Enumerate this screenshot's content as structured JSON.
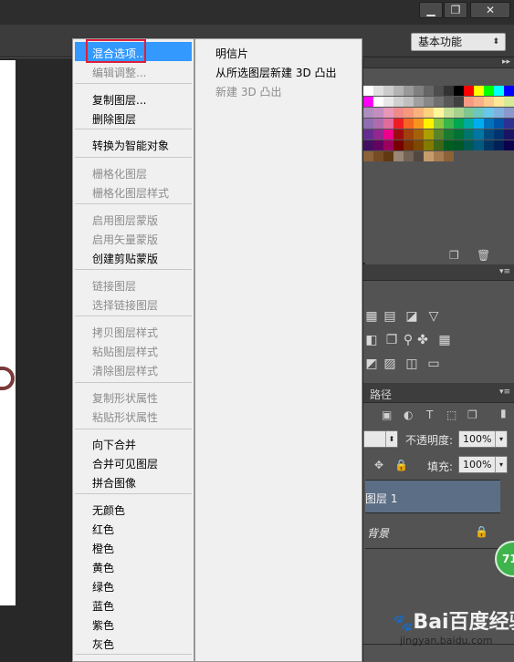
{
  "window": {
    "minimize_glyph": "▁",
    "restore_glyph": "❐",
    "close_glyph": "✕"
  },
  "workspace": {
    "value": "基本功能",
    "arrow": "⬍"
  },
  "menu": {
    "highlighted": "混合选项...",
    "items": [
      {
        "label": "混合选项...",
        "enabled": true
      },
      {
        "label": "编辑调整...",
        "enabled": false
      },
      {
        "label": "复制图层...",
        "enabled": true
      },
      {
        "label": "删除图层",
        "enabled": true
      },
      {
        "label": "转换为智能对象",
        "enabled": true
      },
      {
        "label": "栅格化图层",
        "enabled": false
      },
      {
        "label": "栅格化图层样式",
        "enabled": false
      },
      {
        "label": "启用图层蒙版",
        "enabled": false
      },
      {
        "label": "启用矢量蒙版",
        "enabled": false
      },
      {
        "label": "创建剪贴蒙版",
        "enabled": true
      },
      {
        "label": "链接图层",
        "enabled": false
      },
      {
        "label": "选择链接图层",
        "enabled": false
      },
      {
        "label": "拷贝图层样式",
        "enabled": false
      },
      {
        "label": "粘贴图层样式",
        "enabled": false
      },
      {
        "label": "清除图层样式",
        "enabled": false
      },
      {
        "label": "复制形状属性",
        "enabled": false
      },
      {
        "label": "粘贴形状属性",
        "enabled": false
      },
      {
        "label": "向下合并",
        "enabled": true
      },
      {
        "label": "合并可见图层",
        "enabled": true
      },
      {
        "label": "拼合图像",
        "enabled": true
      },
      {
        "label": "无颜色",
        "enabled": true
      },
      {
        "label": "红色",
        "enabled": true
      },
      {
        "label": "橙色",
        "enabled": true
      },
      {
        "label": "黄色",
        "enabled": true
      },
      {
        "label": "绿色",
        "enabled": true
      },
      {
        "label": "蓝色",
        "enabled": true
      },
      {
        "label": "紫色",
        "enabled": true
      },
      {
        "label": "灰色",
        "enabled": true
      }
    ]
  },
  "submenu": {
    "items": [
      {
        "label": "明信片",
        "enabled": true
      },
      {
        "label": "从所选图层新建 3D 凸出",
        "enabled": true
      },
      {
        "label": "新建 3D 凸出",
        "enabled": false
      }
    ]
  },
  "swatches": {
    "colors": [
      "#ffffff",
      "#e0e0e0",
      "#cccccc",
      "#b3b3b3",
      "#999999",
      "#808080",
      "#666666",
      "#4d4d4d",
      "#333333",
      "#000000",
      "#ff0000",
      "#ffff00",
      "#00ff00",
      "#00ffff",
      "#0000ff",
      "#ff00ff",
      "#ffffff",
      "#e8e8e8",
      "#d0d0d0",
      "#c0c0c0",
      "#a0a0a0",
      "#888888",
      "#707070",
      "#585858",
      "#404040",
      "#f79a83",
      "#f9b08a",
      "#fbca8c",
      "#fde898",
      "#d7ea96",
      "#ae8ebf",
      "#c38ebf",
      "#e897b9",
      "#ef8a8b",
      "#f7987c",
      "#fab27c",
      "#fdd27e",
      "#fff799",
      "#c7e098",
      "#a6d28d",
      "#7fc68f",
      "#6cc8bc",
      "#69c7e8",
      "#7fb1de",
      "#8b98cc",
      "#8e6db0",
      "#b06bad",
      "#e06b9d",
      "#ed1c24",
      "#f26522",
      "#f7941d",
      "#fff200",
      "#8dc63f",
      "#39b54a",
      "#00a651",
      "#00a99d",
      "#00aeef",
      "#0072bc",
      "#0054a6",
      "#2e3192",
      "#662d91",
      "#92278f",
      "#ec008c",
      "#9e0b0f",
      "#a0410d",
      "#a36209",
      "#aba000",
      "#598527",
      "#197b30",
      "#007236",
      "#00746b",
      "#0076a3",
      "#004a80",
      "#003471",
      "#1b1464",
      "#440e62",
      "#630460",
      "#9e005d",
      "#790000",
      "#7b2e00",
      "#7d4900",
      "#827b00",
      "#406618",
      "#005e20",
      "#005826",
      "#005952",
      "#005b7f",
      "#003663",
      "#002157",
      "#0d004c",
      "#8c6239",
      "#754c24",
      "#603913",
      "#998675",
      "#736357",
      "#534741",
      "#c69c6d",
      "#a67c52",
      "#8c6239"
    ]
  },
  "adjustments": {
    "row1": [
      "▦",
      "▤",
      "◪",
      "▽"
    ],
    "row2": [
      "◧",
      "❐",
      "⚲",
      "✤",
      "▦"
    ],
    "row3": [
      "◩",
      "▨",
      "◫",
      "▭"
    ]
  },
  "layers_panel": {
    "tab": "路径",
    "opacity_label": "不透明度:",
    "opacity_value": "100%",
    "fill_label": "填充:",
    "fill_value": "100%",
    "layers": [
      {
        "name": "图层 1",
        "selected": true
      },
      {
        "name": "背景",
        "selected": false
      }
    ]
  },
  "badge": {
    "text": "71"
  },
  "watermark": {
    "logo": "Bai百度经验",
    "sub": "jingyan.baidu.com"
  }
}
